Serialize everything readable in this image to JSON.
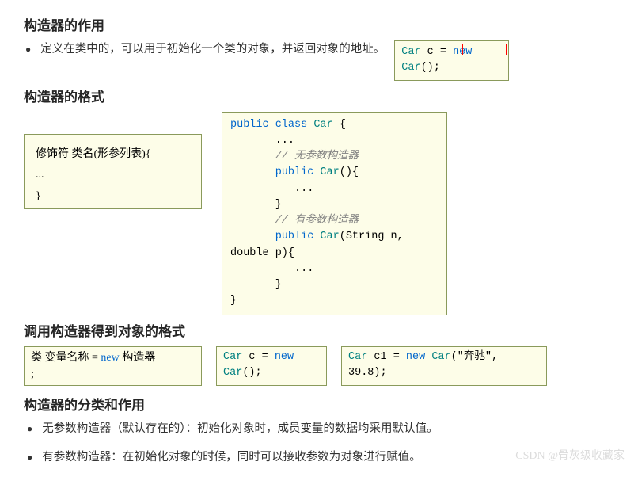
{
  "s1": {
    "title": "构造器的作用",
    "bullet": "定义在类中的，可以用于初始化一个类的对象，并返回对象的地址。"
  },
  "box_top": {
    "l1a": "Car",
    "l1b": " c = ",
    "l1c": "new",
    "l2a": "Car",
    "l2b": "();"
  },
  "s2": {
    "title": "构造器的格式"
  },
  "format_box": {
    "l1": "修饰符 类名(形参列表){",
    "l2": "   ...",
    "l3": "}"
  },
  "big_box": {
    "l1a": "public class ",
    "l1b": "Car",
    "l1c": " {",
    "l2": "       ...",
    "l3": "       // 无参数构造器",
    "l4a": "       public ",
    "l4b": "Car",
    "l4c": "(){",
    "l5": "          ...",
    "l6": "       }",
    "l7": "       // 有参数构造器",
    "l8a": "       public ",
    "l8b": "Car",
    "l8c": "(String n,",
    "l9": "double p){",
    "l10": "          ...",
    "l11": "       }",
    "l12": "}"
  },
  "s3": {
    "title": "调用构造器得到对象的格式"
  },
  "r3a": {
    "l1a": "类 变量名称 = ",
    "l1b": "new",
    "l1c": " 构造器",
    "l2": ";"
  },
  "r3b": {
    "l1a": "Car",
    "l1b": " c = ",
    "l1c": "new",
    "l2a": "Car",
    "l2b": "();"
  },
  "r3c": {
    "a": "Car",
    "b": " c1 = ",
    "c": "new ",
    "d": "Car",
    "e": "(\"奔驰\",",
    "l2": "39.8);"
  },
  "s4": {
    "title": "构造器的分类和作用",
    "b1": "无参数构造器（默认存在的）：初始化对象时，成员变量的数据均采用默认值。",
    "b2": "有参数构造器：在初始化对象的时候，同时可以接收参数为对象进行赋值。"
  },
  "watermark": "CSDN @骨灰级收藏家",
  "chart_data": {
    "type": "table",
    "content": "Java constructor tutorial slide: sections on purpose, format, invocation, classification of constructors"
  }
}
